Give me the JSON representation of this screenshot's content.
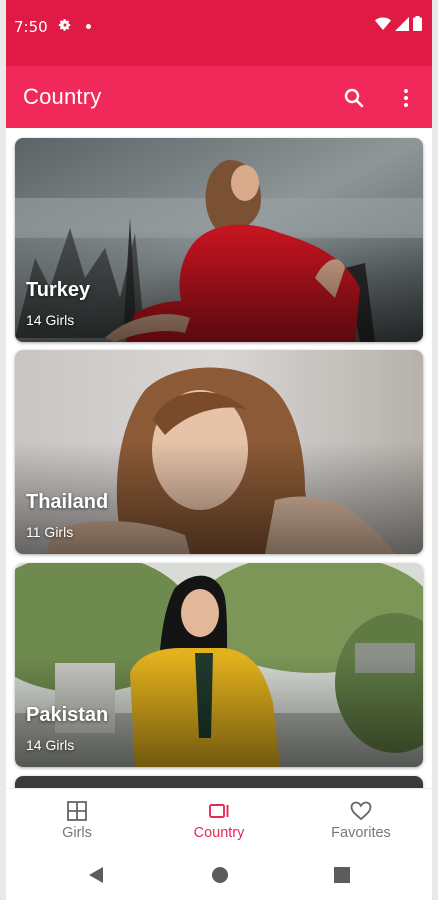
{
  "status_bar": {
    "time": "7:50",
    "icons": [
      "settings-gear-icon",
      "notification-dot-icon",
      "wifi-icon",
      "cell-signal-icon",
      "battery-icon"
    ]
  },
  "app_bar": {
    "title": "Country",
    "actions": [
      "search-icon",
      "more-vert-icon"
    ]
  },
  "countries": [
    {
      "name": "Turkey",
      "count": "14 Girls"
    },
    {
      "name": "Thailand",
      "count": "11 Girls"
    },
    {
      "name": "Pakistan",
      "count": "14 Girls"
    }
  ],
  "bottom_nav": {
    "items": [
      {
        "label": "Girls",
        "icon": "grid-icon",
        "active": false
      },
      {
        "label": "Country",
        "icon": "country-icon",
        "active": true
      },
      {
        "label": "Favorites",
        "icon": "heart-icon",
        "active": false
      }
    ]
  },
  "system_nav": [
    "back-icon",
    "home-icon",
    "recents-icon"
  ],
  "colors": {
    "status_bar": "#de1a45",
    "app_bar": "#f0295a",
    "accent": "#e8285a",
    "inactive": "#777777"
  }
}
